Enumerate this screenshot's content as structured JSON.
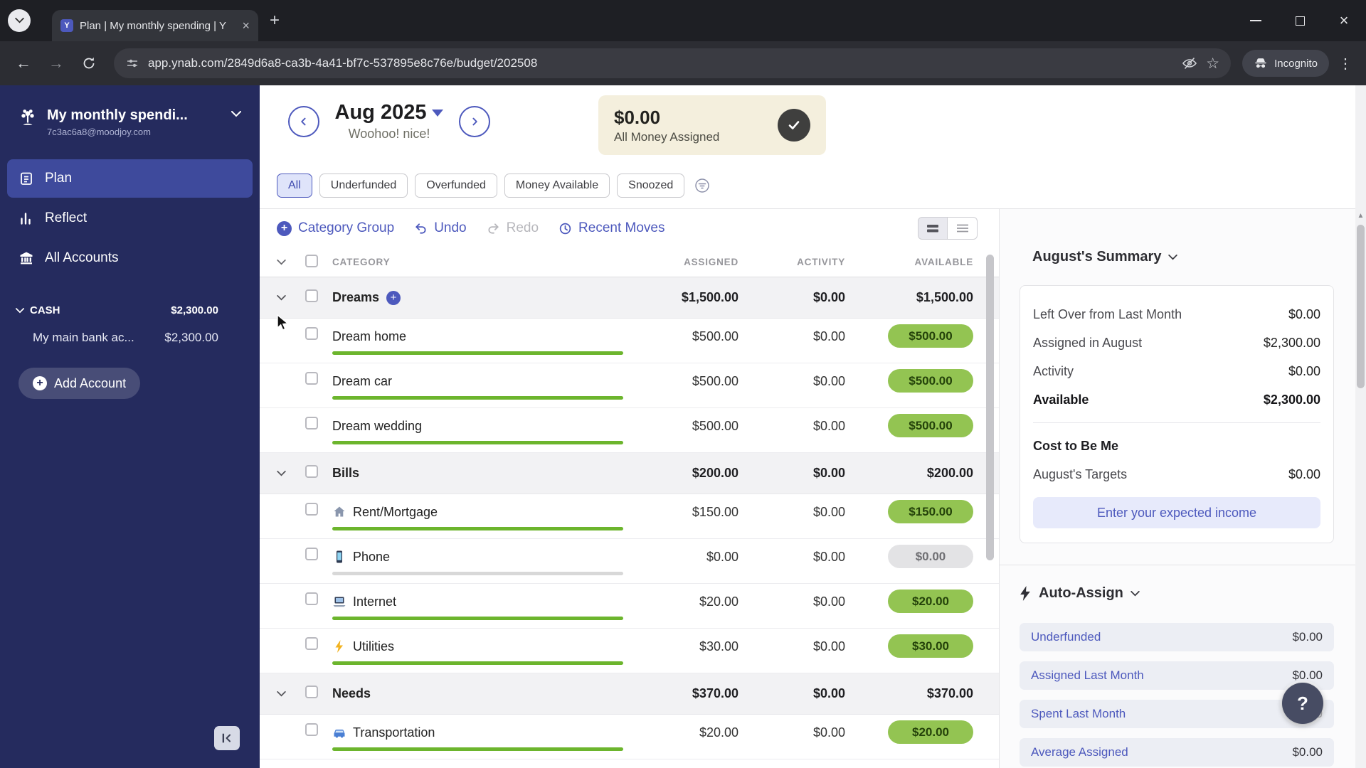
{
  "colors": {
    "accent_blurple": "#4d59bd",
    "sidebar_navy": "#252b5e",
    "active_nav": "#3e4a9c",
    "pill_green_bg": "#93c452",
    "pill_green_text": "#24420a",
    "progress_green": "#6cb52d",
    "banner_beige": "#f4efdd"
  },
  "browser": {
    "tab_title": "Plan | My monthly spending | Y",
    "url": "app.ynab.com/2849d6a8-ca3b-4a41-bf7c-537895e8c76e/budget/202508",
    "incognito_label": "Incognito"
  },
  "sidebar": {
    "budget_name": "My monthly spendi...",
    "email": "7c3ac6a8@moodjoy.com",
    "nav": [
      {
        "label": "Plan",
        "icon": "plan-icon",
        "active": true
      },
      {
        "label": "Reflect",
        "icon": "reflect-icon",
        "active": false
      },
      {
        "label": "All Accounts",
        "icon": "accounts-icon",
        "active": false
      }
    ],
    "cash_group": {
      "label": "CASH",
      "amount": "$2,300.00"
    },
    "accounts": [
      {
        "label": "My main bank ac...",
        "amount": "$2,300.00"
      }
    ],
    "add_account_label": "Add Account"
  },
  "header": {
    "month": "Aug 2025",
    "subtitle": "Woohoo! nice!",
    "banner_amount": "$0.00",
    "banner_label": "All Money Assigned"
  },
  "filters": {
    "items": [
      "All",
      "Underfunded",
      "Overfunded",
      "Money Available",
      "Snoozed"
    ],
    "active": "All"
  },
  "toolbar": {
    "category_group_label": "Category Group",
    "undo_label": "Undo",
    "redo_label": "Redo",
    "recent_moves_label": "Recent Moves"
  },
  "table": {
    "columns": [
      "CATEGORY",
      "ASSIGNED",
      "ACTIVITY",
      "AVAILABLE"
    ],
    "groups": [
      {
        "name": "Dreams",
        "assigned": "$1,500.00",
        "activity": "$0.00",
        "available": "$1,500.00",
        "show_add": true,
        "rows": [
          {
            "name": "Dream home",
            "icon": "",
            "assigned": "$500.00",
            "activity": "$0.00",
            "available": "$500.00",
            "pill": "green"
          },
          {
            "name": "Dream car",
            "icon": "",
            "assigned": "$500.00",
            "activity": "$0.00",
            "available": "$500.00",
            "pill": "green"
          },
          {
            "name": "Dream wedding",
            "icon": "",
            "assigned": "$500.00",
            "activity": "$0.00",
            "available": "$500.00",
            "pill": "green"
          }
        ]
      },
      {
        "name": "Bills",
        "assigned": "$200.00",
        "activity": "$0.00",
        "available": "$200.00",
        "show_add": false,
        "rows": [
          {
            "name": "Rent/Mortgage",
            "icon": "house-icon",
            "assigned": "$150.00",
            "activity": "$0.00",
            "available": "$150.00",
            "pill": "green"
          },
          {
            "name": "Phone",
            "icon": "phone-icon",
            "assigned": "$0.00",
            "activity": "$0.00",
            "available": "$0.00",
            "pill": "gray"
          },
          {
            "name": "Internet",
            "icon": "laptop-icon",
            "assigned": "$20.00",
            "activity": "$0.00",
            "available": "$20.00",
            "pill": "green"
          },
          {
            "name": "Utilities",
            "icon": "bolt-icon",
            "assigned": "$30.00",
            "activity": "$0.00",
            "available": "$30.00",
            "pill": "green"
          }
        ]
      },
      {
        "name": "Needs",
        "assigned": "$370.00",
        "activity": "$0.00",
        "available": "$370.00",
        "show_add": false,
        "rows": [
          {
            "name": "Transportation",
            "icon": "car-icon",
            "assigned": "$20.00",
            "activity": "$0.00",
            "available": "$20.00",
            "pill": "green"
          }
        ]
      }
    ]
  },
  "summary": {
    "title": "August's Summary",
    "rows": [
      {
        "label": "Left Over from Last Month",
        "value": "$0.00",
        "bold": false
      },
      {
        "label": "Assigned in August",
        "value": "$2,300.00",
        "bold": false
      },
      {
        "label": "Activity",
        "value": "$0.00",
        "bold": false
      },
      {
        "label": "Available",
        "value": "$2,300.00",
        "bold": true
      }
    ],
    "cost_title": "Cost to Be Me",
    "targets_row": {
      "label": "August's Targets",
      "value": "$0.00"
    },
    "income_button_label": "Enter your expected income"
  },
  "auto_assign": {
    "title": "Auto-Assign",
    "rows": [
      {
        "label": "Underfunded",
        "value": "$0.00"
      },
      {
        "label": "Assigned Last Month",
        "value": "$0.00"
      },
      {
        "label": "Spent Last Month",
        "value": "$0.00"
      },
      {
        "label": "Average Assigned",
        "value": "$0.00"
      }
    ]
  },
  "help": {
    "label": "?"
  }
}
